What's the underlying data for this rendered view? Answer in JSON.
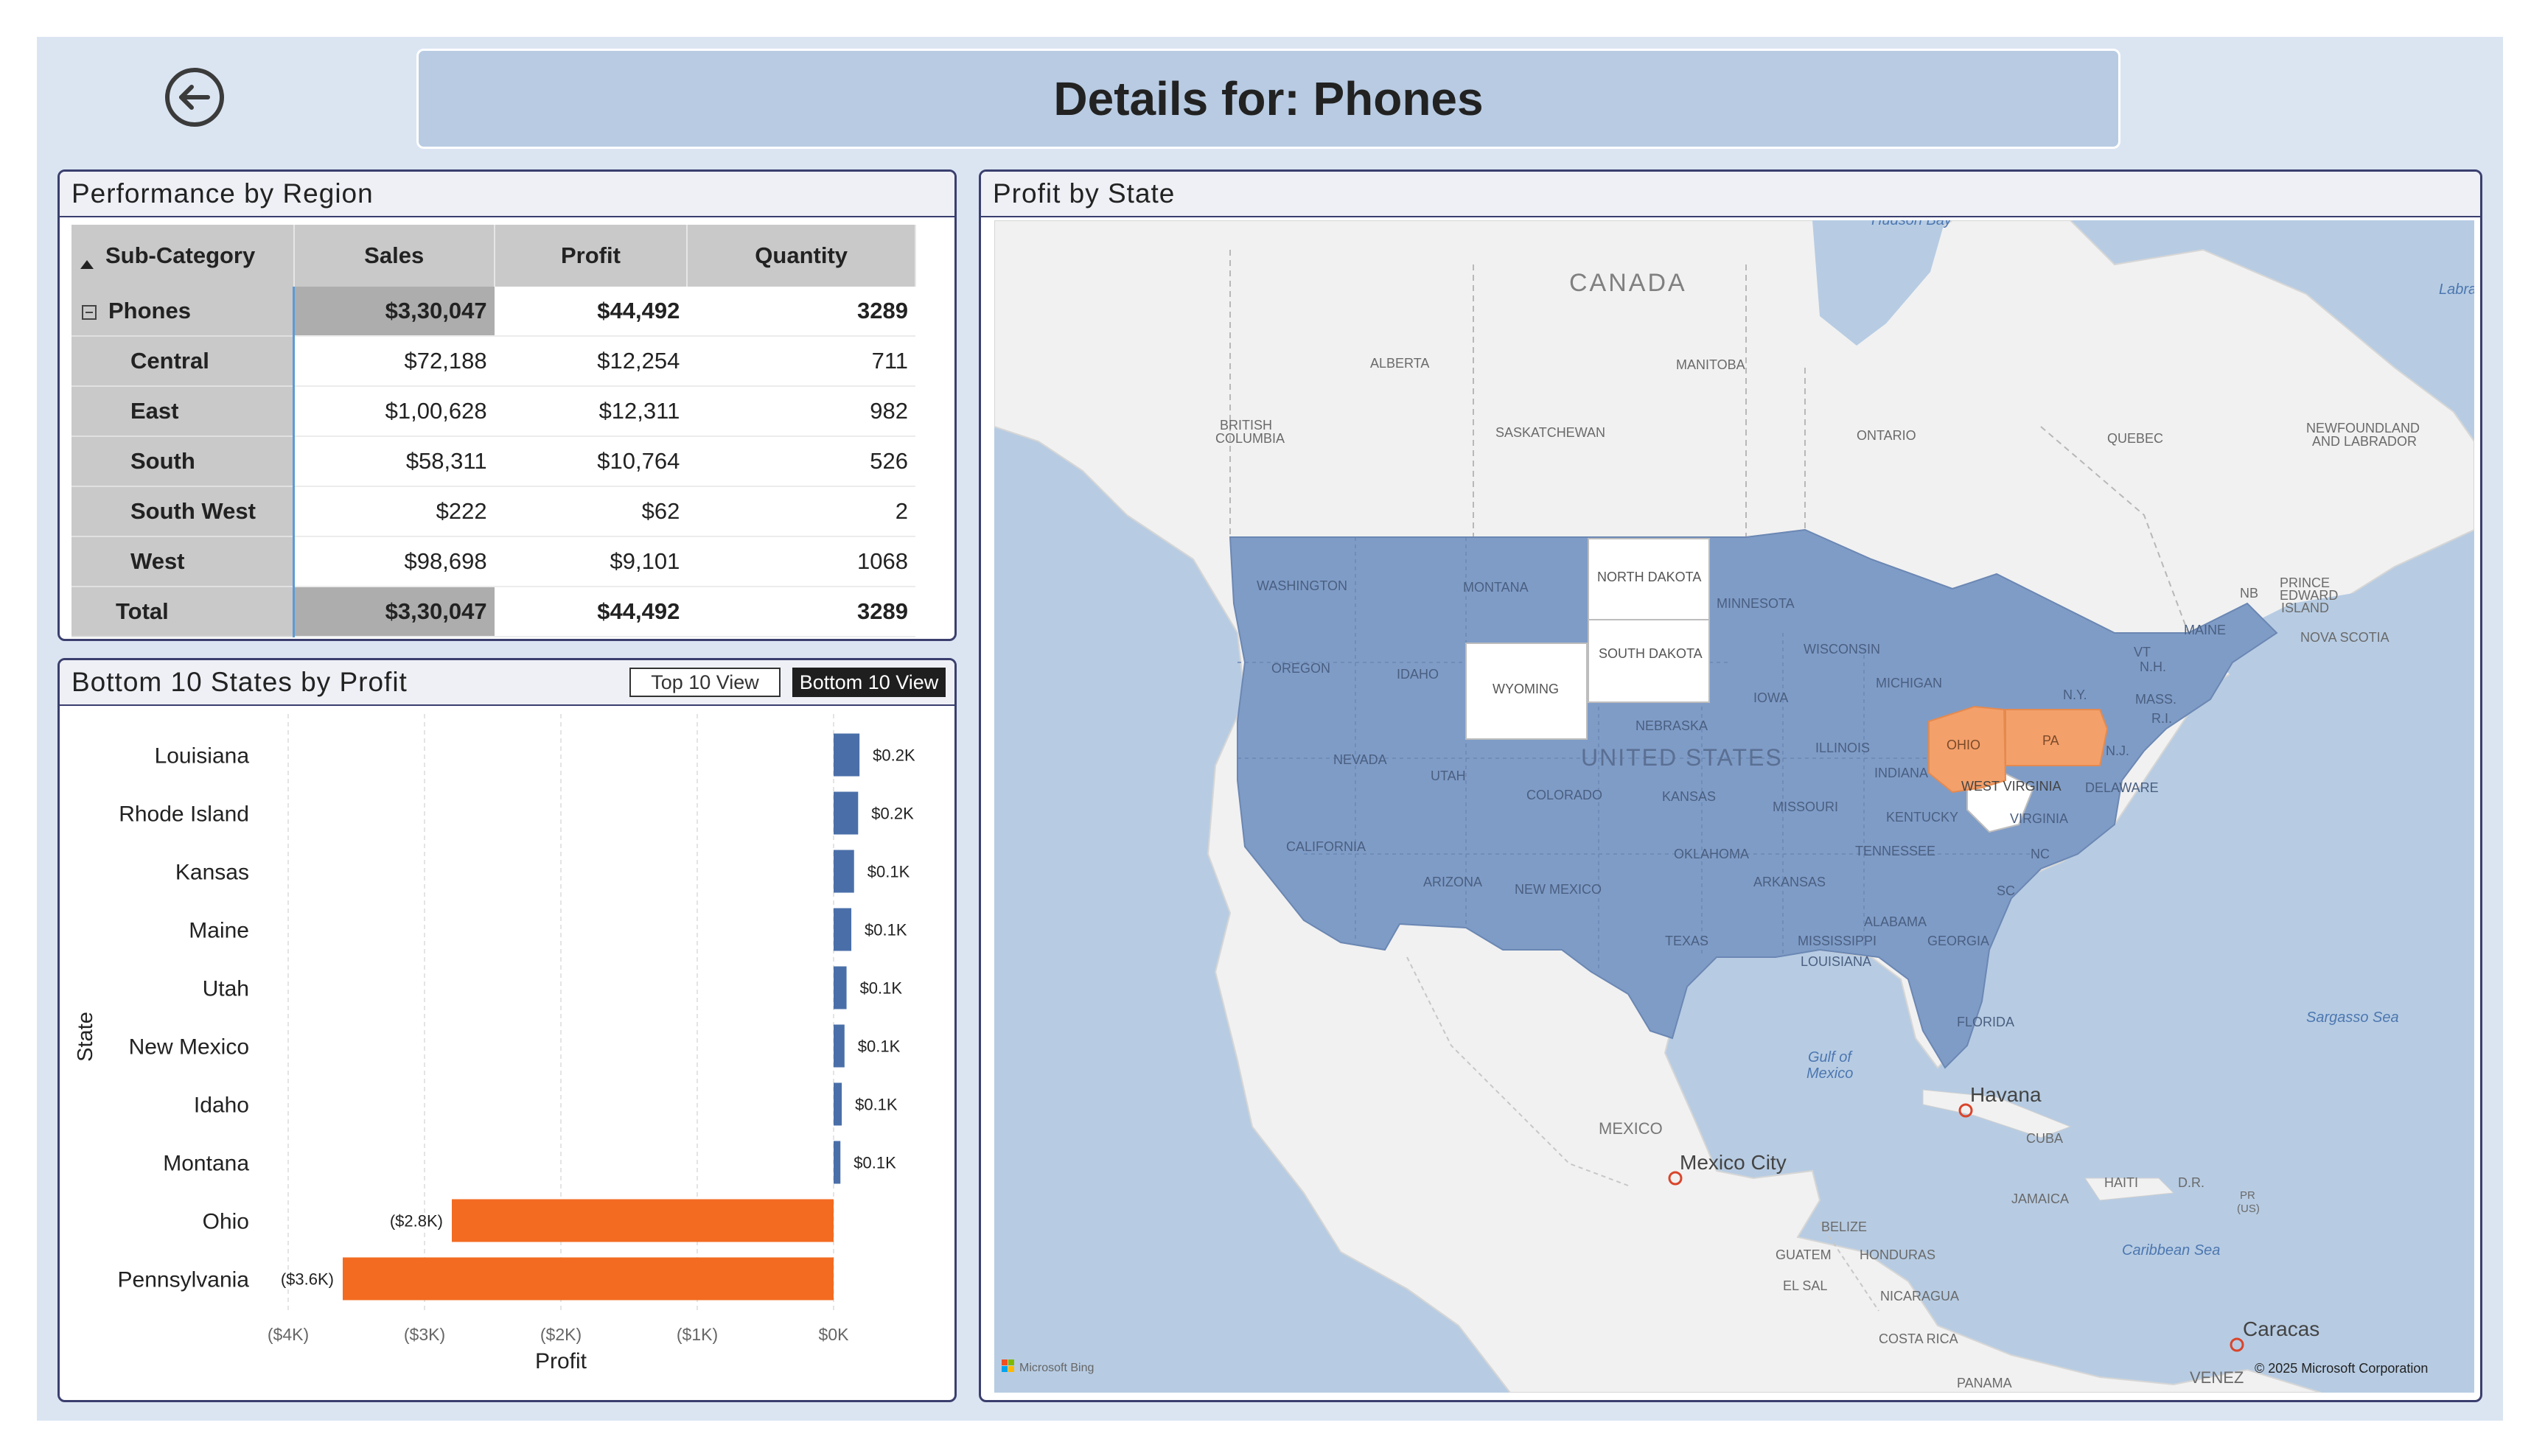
{
  "header": {
    "title": "Details for: Phones",
    "back_icon": "back-arrow-circle-icon"
  },
  "performance": {
    "panel_title": "Performance by Region",
    "columns": [
      "Sub-Category",
      "Sales",
      "Profit",
      "Quantity"
    ],
    "group": {
      "label": "Phones",
      "sales": "$3,30,047",
      "profit": "$44,492",
      "quantity": "3289"
    },
    "rows": [
      {
        "label": "Central",
        "sales": "$72,188",
        "profit": "$12,254",
        "quantity": "711"
      },
      {
        "label": "East",
        "sales": "$1,00,628",
        "profit": "$12,311",
        "quantity": "982"
      },
      {
        "label": "South",
        "sales": "$58,311",
        "profit": "$10,764",
        "quantity": "526"
      },
      {
        "label": "South West",
        "sales": "$222",
        "profit": "$62",
        "quantity": "2"
      },
      {
        "label": "West",
        "sales": "$98,698",
        "profit": "$9,101",
        "quantity": "1068"
      }
    ],
    "total": {
      "label": "Total",
      "sales": "$3,30,047",
      "profit": "$44,492",
      "quantity": "3289"
    }
  },
  "bottom10": {
    "panel_title": "Bottom 10 States by Profit",
    "toggle_top": "Top 10 View",
    "toggle_bottom": "Bottom 10 View",
    "active_view": "Bottom 10 View"
  },
  "chart_data": {
    "type": "bar",
    "orientation": "horizontal",
    "categories": [
      "Louisiana",
      "Rhode Island",
      "Kansas",
      "Maine",
      "Utah",
      "New Mexico",
      "Idaho",
      "Montana",
      "Ohio",
      "Pennsylvania"
    ],
    "values": [
      190,
      180,
      150,
      130,
      95,
      80,
      60,
      50,
      -2800,
      -3600
    ],
    "data_labels": [
      "$0.2K",
      "$0.2K",
      "$0.1K",
      "$0.1K",
      "$0.1K",
      "$0.1K",
      "$0.1K",
      "$0.1K",
      "($2.8K)",
      "($3.6K)"
    ],
    "xlabel": "Profit",
    "ylabel": "State",
    "xlim": [
      -4000,
      0
    ],
    "xticks": [
      -4000,
      -3000,
      -2000,
      -1000,
      0
    ],
    "xtick_labels": [
      "($4K)",
      "($3K)",
      "($2K)",
      "($1K)",
      "$0K"
    ],
    "colors": {
      "positive": "#4a6fa8",
      "negative": "#f26b21"
    },
    "grid": "vertical dashed"
  },
  "map": {
    "panel_title": "Profit by State",
    "attribution": "© 2025 Microsoft Corporation",
    "provider": "Microsoft Bing",
    "colors": {
      "water": "#b7cce3",
      "land": "#f1f1f1",
      "profit_positive": "#7f9cc7",
      "profit_negative": "#f4a06a",
      "no_data": "#ffffff"
    },
    "labels": {
      "hudson_bay": "Hudson Bay",
      "labrador": "Labrad",
      "canada": "CANADA",
      "alberta": "ALBERTA",
      "manitoba": "MANITOBA",
      "british_columbia_1": "BRITISH",
      "british_columbia_2": "COLUMBIA",
      "saskatchewan": "SASKATCHEWAN",
      "ontario": "ONTARIO",
      "quebec": "QUEBEC",
      "newfoundland_1": "NEWFOUNDLAND",
      "newfoundland_2": "AND LABRADOR",
      "pei_1": "PRINCE",
      "pei_2": "EDWARD",
      "pei_3": "ISLAND",
      "nb": "NB",
      "nova_scotia": "NOVA SCOTIA",
      "washington": "WASHINGTON",
      "montana": "MONTANA",
      "north_dakota": "NORTH DAKOTA",
      "minnesota": "MINNESOTA",
      "south_dakota": "SOUTH DAKOTA",
      "oregon": "OREGON",
      "idaho": "IDAHO",
      "wyoming": "WYOMING",
      "wisconsin": "WISCONSIN",
      "michigan": "MICHIGAN",
      "maine": "MAINE",
      "vt": "VT",
      "nh": "N.H.",
      "ny": "N.Y.",
      "mass": "MASS.",
      "ri": "R.I.",
      "nebraska": "NEBRASKA",
      "iowa": "IOWA",
      "united_states": "UNITED STATES",
      "illinois": "ILLINOIS",
      "indiana": "INDIANA",
      "ohio": "OHIO",
      "pa": "PA",
      "nj": "N.J.",
      "delaware": "DELAWARE",
      "west_virginia": "WEST VIRGINIA",
      "virginia": "VIRGINIA",
      "nevada": "NEVADA",
      "utah": "UTAH",
      "colorado": "COLORADO",
      "kansas": "KANSAS",
      "missouri": "MISSOURI",
      "kentucky": "KENTUCKY",
      "california": "CALIFORNIA",
      "oklahoma": "OKLAHOMA",
      "tennessee": "TENNESSEE",
      "nc": "NC",
      "arizona": "ARIZONA",
      "new_mexico": "NEW MEXICO",
      "arkansas": "ARKANSAS",
      "sc": "SC",
      "alabama": "ALABAMA",
      "texas": "TEXAS",
      "mississippi": "MISSISSIPPI",
      "georgia": "GEORGIA",
      "louisiana": "LOUISIANA",
      "florida": "FLORIDA",
      "gulf_1": "Gulf of",
      "gulf_2": "Mexico",
      "havana": "Havana",
      "mexico": "MEXICO",
      "mexico_city": "Mexico City",
      "cuba": "CUBA",
      "haiti": "HAITI",
      "dr": "D.R.",
      "pr_1": "PR",
      "pr_2": "(US)",
      "jamaica": "JAMAICA",
      "belize": "BELIZE",
      "guatemala": "GUATEM",
      "honduras": "HONDURAS",
      "el_salvador": "EL SAL",
      "nicaragua": "NICARAGUA",
      "costa_rica": "COSTA RICA",
      "panama": "PANAMA",
      "caracas": "Caracas",
      "venezuela": "VENEZ",
      "caribbean_sea": "Caribbean Sea",
      "sargasso_sea": "Sargasso Sea"
    }
  }
}
